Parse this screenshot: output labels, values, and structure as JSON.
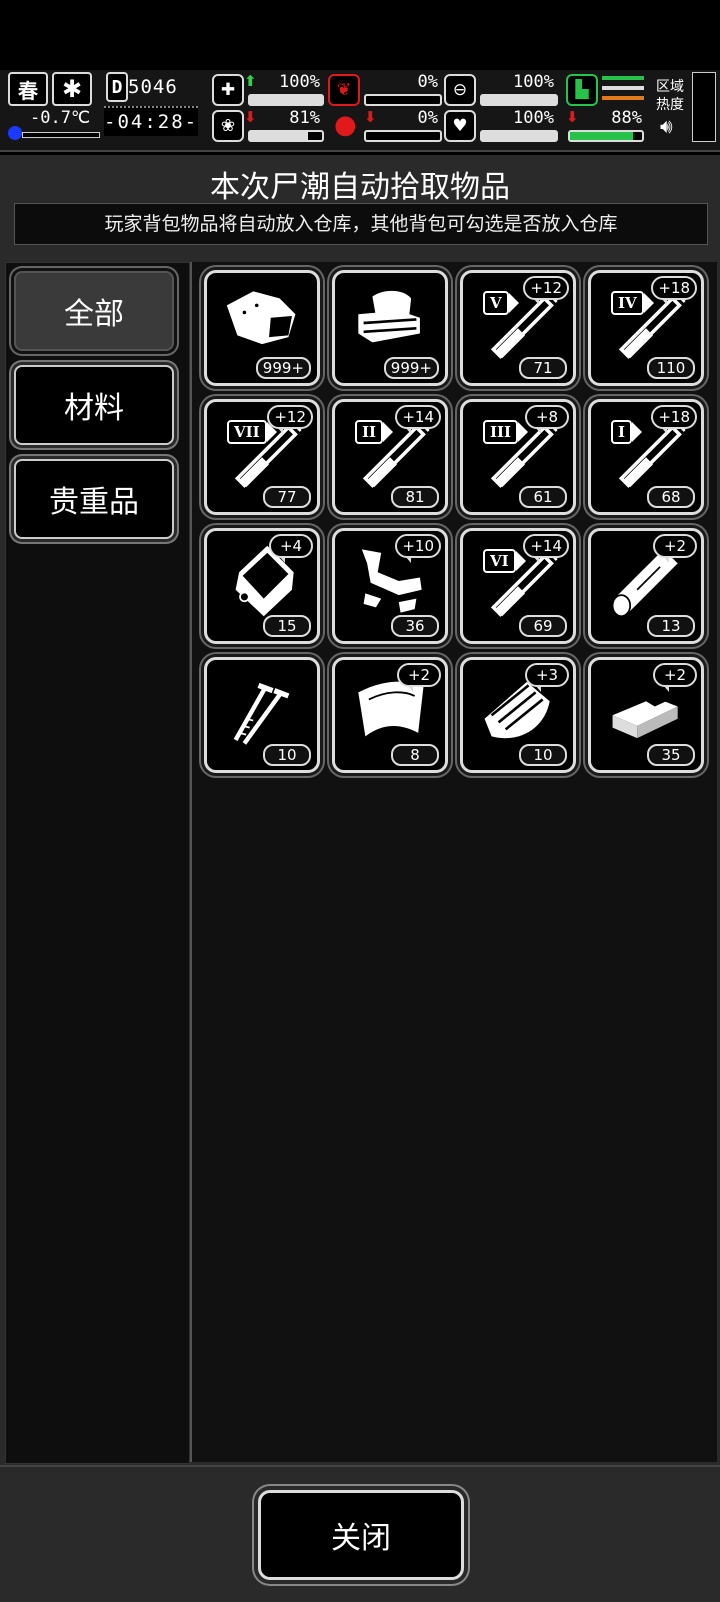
{
  "hud": {
    "season": "春",
    "temperature": "-0.7℃",
    "day_label": "D",
    "day_number": "5046",
    "clock": "-04:28-",
    "region_heat_label": "区域\n热度",
    "stats": [
      {
        "name": "health",
        "icon": "medkit-icon",
        "trend": "up",
        "value": "100%",
        "level": 1.0
      },
      {
        "name": "stomach",
        "icon": "stomach-icon",
        "trend": "none",
        "value": "0%",
        "level": 0.0
      },
      {
        "name": "capsule",
        "icon": "capsule-icon",
        "trend": "none",
        "value": "100%",
        "level": 1.0
      },
      {
        "name": "stamina",
        "icon": "boot-icon",
        "trend": "none",
        "value": "",
        "level": 1.0
      },
      {
        "name": "brain",
        "icon": "brain-icon",
        "trend": "down",
        "value": "81%",
        "level": 0.81
      },
      {
        "name": "blood",
        "icon": "blood-drop-icon",
        "trend": "down",
        "value": "0%",
        "level": 0.0
      },
      {
        "name": "mood",
        "icon": "heart-icon",
        "trend": "none",
        "value": "100%",
        "level": 1.0
      },
      {
        "name": "battery",
        "icon": "battery-icon",
        "trend": "down",
        "value": "88%",
        "level": 0.88
      }
    ],
    "colors": {
      "up": "#2ed14a",
      "down": "#e01a1a",
      "green_bar": "#27c24a",
      "orange": "#e07a1a"
    }
  },
  "dialog": {
    "title": "本次尸潮自动拾取物品",
    "subtitle": "玩家背包物品将自动放入仓库，其他背包可勾选是否放入仓库",
    "tabs": [
      {
        "label": "全部",
        "active": true
      },
      {
        "label": "材料",
        "active": false
      },
      {
        "label": "贵重品",
        "active": false
      }
    ],
    "items": [
      {
        "icon": "meat-icon",
        "count": "999+",
        "badge": "",
        "roman": ""
      },
      {
        "icon": "cloth-stack-icon",
        "count": "999+",
        "badge": "",
        "roman": ""
      },
      {
        "icon": "syringe-icon",
        "count": "71",
        "badge": "+12",
        "roman": "V"
      },
      {
        "icon": "syringe-icon",
        "count": "110",
        "badge": "+18",
        "roman": "IV"
      },
      {
        "icon": "syringe-icon",
        "count": "77",
        "badge": "+12",
        "roman": "VII"
      },
      {
        "icon": "syringe-icon",
        "count": "81",
        "badge": "+14",
        "roman": "II"
      },
      {
        "icon": "syringe-icon",
        "count": "61",
        "badge": "+8",
        "roman": "III"
      },
      {
        "icon": "syringe-icon",
        "count": "68",
        "badge": "+18",
        "roman": "I"
      },
      {
        "icon": "plastic-bag-icon",
        "count": "15",
        "badge": "+4",
        "roman": ""
      },
      {
        "icon": "scrap-metal-icon",
        "count": "36",
        "badge": "+10",
        "roman": ""
      },
      {
        "icon": "syringe-icon",
        "count": "69",
        "badge": "+14",
        "roman": "VI"
      },
      {
        "icon": "log-icon",
        "count": "13",
        "badge": "+2",
        "roman": ""
      },
      {
        "icon": "nails-icon",
        "count": "10",
        "badge": "",
        "roman": ""
      },
      {
        "icon": "leather-icon",
        "count": "8",
        "badge": "+2",
        "roman": ""
      },
      {
        "icon": "wood-planks-icon",
        "count": "10",
        "badge": "+3",
        "roman": ""
      },
      {
        "icon": "brick-icon",
        "count": "35",
        "badge": "+2",
        "roman": ""
      }
    ],
    "close_label": "关闭"
  }
}
